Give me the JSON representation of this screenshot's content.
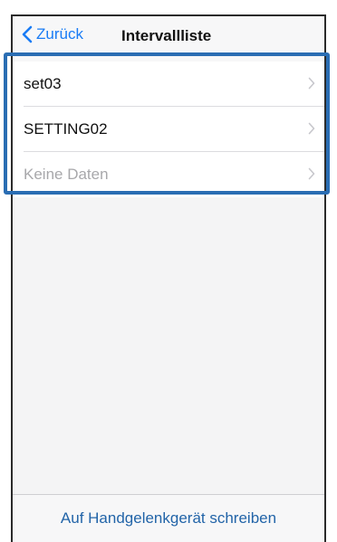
{
  "nav": {
    "back_label": "Zurück",
    "title": "Intervallliste"
  },
  "list": {
    "items": [
      {
        "label": "set03",
        "placeholder": false
      },
      {
        "label": "SETTING02",
        "placeholder": false
      },
      {
        "label": "Keine Daten",
        "placeholder": true
      }
    ]
  },
  "footer": {
    "action_label": "Auf Handgelenkgerät schreiben"
  },
  "colors": {
    "accent": "#1a7cf5",
    "highlight": "#2a6db3",
    "placeholder_text": "#a8a8ab"
  },
  "icons": [
    "chevron-left-icon",
    "chevron-right-icon"
  ]
}
